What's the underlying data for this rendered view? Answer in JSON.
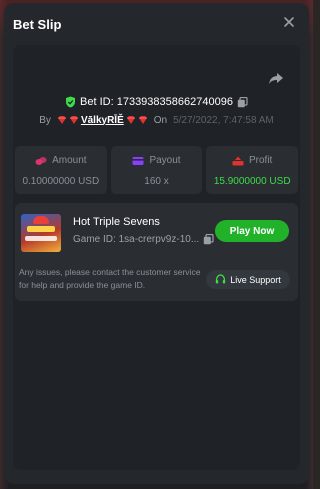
{
  "modal": {
    "title": "Bet Slip",
    "close_icon": "close-icon"
  },
  "bet": {
    "id_label": "Bet ID: 1733938358662740096",
    "by_label": "By",
    "username": "VālkyRĪĚ",
    "on_label": "On",
    "date": "5/27/2022, 7:47:58 AM"
  },
  "stats": [
    {
      "label": "Amount",
      "value": "0.10000000 USD",
      "icon": "coins-icon",
      "icon_color": "#e0336b"
    },
    {
      "label": "Payout",
      "value": "160 x",
      "icon": "card-icon",
      "icon_color": "#8a3ffc"
    },
    {
      "label": "Profit",
      "value": "15.9000000 USD",
      "icon": "profit-icon",
      "icon_color": "#e0332f",
      "value_color": "#3ddc49"
    }
  ],
  "game": {
    "name": "Hot Triple Sevens",
    "id_text": "Game ID: 1sa-crerpv9z-10...",
    "play_label": "Play Now"
  },
  "support": {
    "notice": "Any issues, please contact the customer service for help and provide the game ID.",
    "button_label": "Live Support"
  },
  "colors": {
    "accent_green": "#22b22a",
    "profit_green": "#3ddc49",
    "panel": "#24272b"
  }
}
